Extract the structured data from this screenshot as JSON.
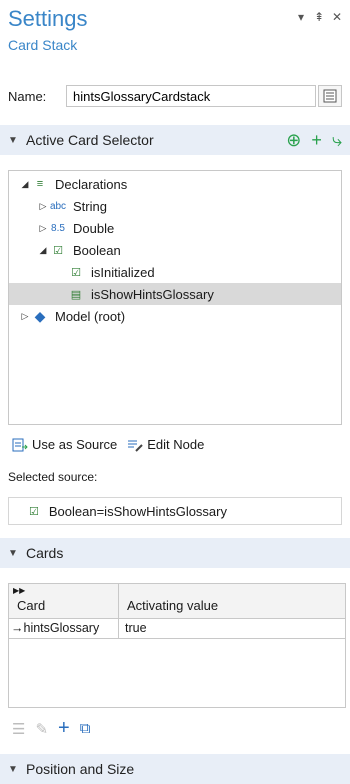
{
  "header": {
    "title": "Settings",
    "subtitle": "Card Stack"
  },
  "window_controls": [
    "▾",
    "⇞",
    "✕"
  ],
  "name": {
    "label": "Name:",
    "value": "hintsGlossaryCardstack"
  },
  "active_card_selector": {
    "title": "Active Card Selector",
    "tree": [
      {
        "label": "Declarations",
        "icon": "≡",
        "expanded": true,
        "indent": 0
      },
      {
        "label": "String",
        "icon": "abc",
        "expanded": false,
        "indent": 1
      },
      {
        "label": "Double",
        "icon": "8.5",
        "expanded": false,
        "indent": 1
      },
      {
        "label": "Boolean",
        "icon": "☑",
        "expanded": true,
        "indent": 1
      },
      {
        "label": "isInitialized",
        "icon": "☑",
        "indent": 2
      },
      {
        "label": "isShowHintsGlossary",
        "icon": "▤",
        "indent": 2,
        "selected": true
      },
      {
        "label": "Model (root)",
        "icon": "◆",
        "expanded": false,
        "indent": 0
      }
    ],
    "use_as_source_label": "Use as Source",
    "edit_node_label": "Edit Node",
    "selected_source_label": "Selected source:",
    "selected_source_value": "Boolean=isShowHintsGlossary"
  },
  "cards": {
    "title": "Cards",
    "columns": [
      "Card",
      "Activating value"
    ],
    "rows": [
      {
        "card": "→hintsGlossary",
        "value": "true"
      }
    ]
  },
  "position_and_size": {
    "title": "Position and Size"
  }
}
